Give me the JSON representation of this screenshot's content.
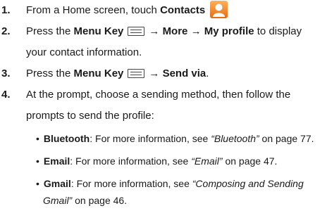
{
  "steps": [
    {
      "num": "1.",
      "pre": "From a Home screen, touch ",
      "bold": "Contacts",
      "post": ""
    },
    {
      "num": "2.",
      "pre": "Press the ",
      "bold1": "Menu Key",
      "arrow1": "→",
      "bold2": "More",
      "arrow2": "→",
      "bold3": "My profile",
      "post": " to display",
      "line2": "your contact information."
    },
    {
      "num": "3.",
      "pre": "Press the ",
      "bold1": "Menu Key",
      "arrow": "→",
      "bold2": "Send via",
      "post": "."
    },
    {
      "num": "4.",
      "line1": "At the prompt, choose a sending method, then follow the",
      "line2": "prompts to send the profile:"
    }
  ],
  "bullets": [
    {
      "bullet": "•",
      "bold": "Bluetooth",
      "text": ": For more information, see ",
      "ref": "“Bluetooth”",
      "page": " on page 77."
    },
    {
      "bullet": "•",
      "bold": "Email",
      "text": ": For more information, see ",
      "ref": "“Email”",
      "page": " on page 47."
    },
    {
      "bullet": "•",
      "bold": "Gmail",
      "text": ": For more information, see ",
      "ref": "“Composing and Sending",
      "ref2": "Gmail”",
      "page": " on page 46."
    }
  ],
  "icons": {
    "contacts": "contacts-app-icon",
    "menu": "menu-key-icon"
  }
}
